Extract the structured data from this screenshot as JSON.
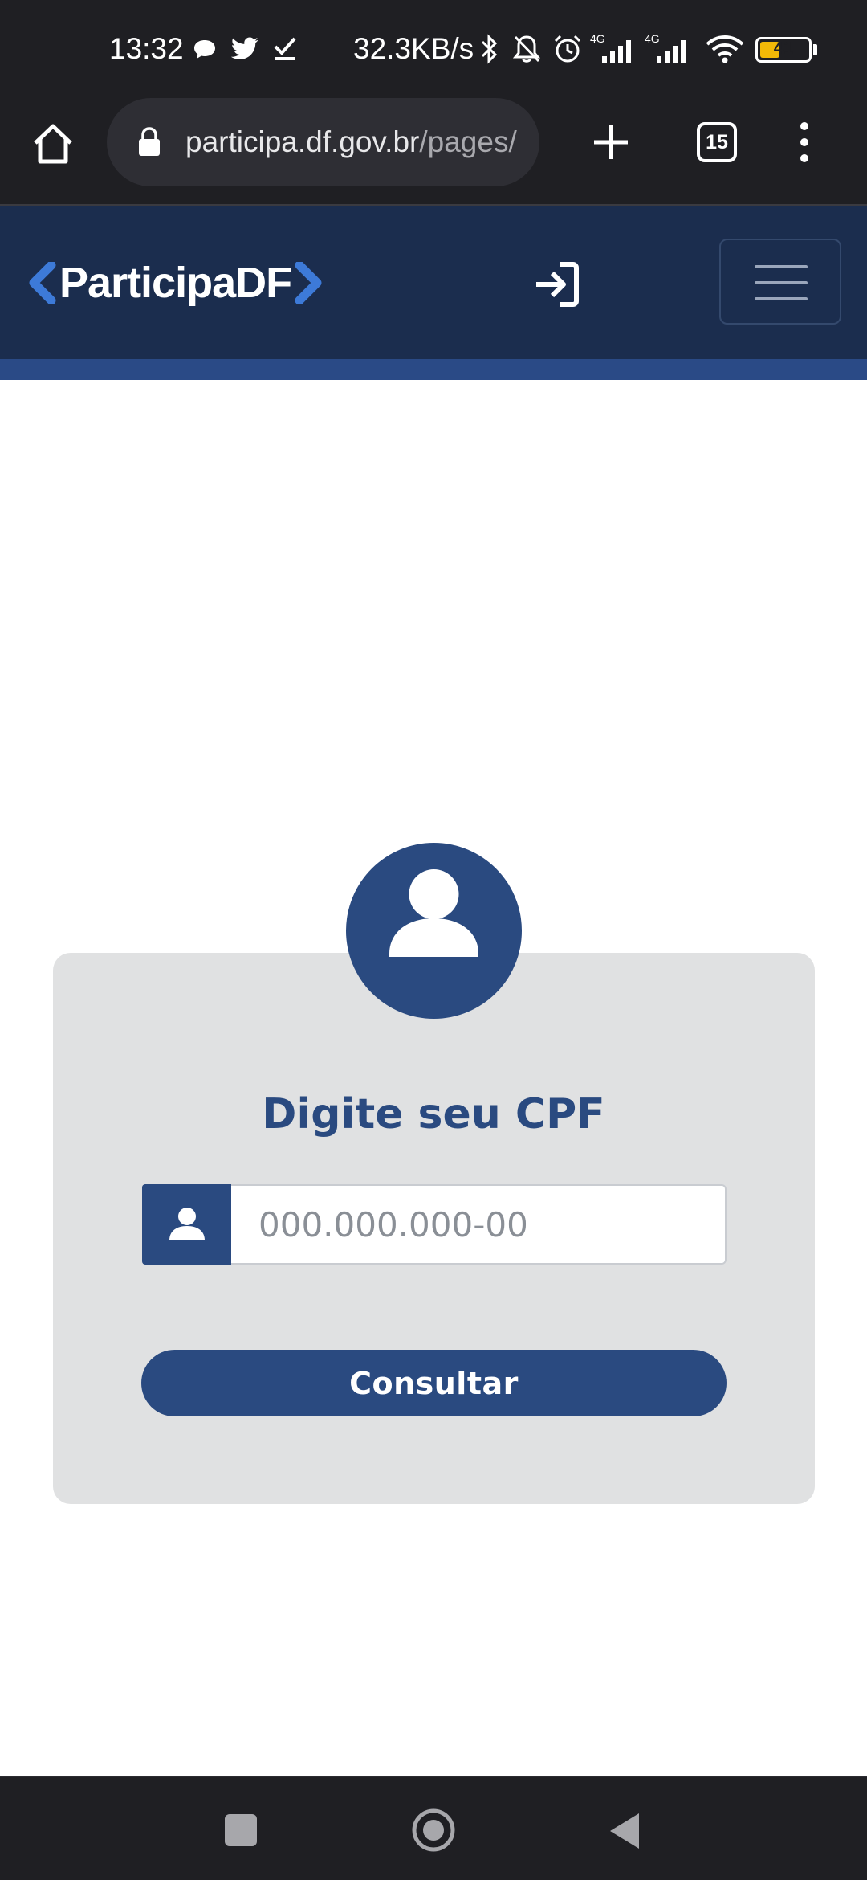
{
  "status_bar": {
    "time": "13:32",
    "net_speed": "32.3KB/s",
    "battery_level": "41",
    "battery_fraction": 0.41,
    "icons": [
      "chat-bubble-icon",
      "twitter-icon",
      "check-icon",
      "bluetooth-icon",
      "bell-off-icon",
      "alarm-icon",
      "signal-4g-icon",
      "signal-4g-icon",
      "wifi-icon",
      "battery-icon"
    ],
    "signal_label": "4G"
  },
  "browser": {
    "url_main": "participa.df.gov.br",
    "url_path": "/pages/",
    "tab_count": "15",
    "icons": {
      "home": "home-icon",
      "lock": "lock-icon",
      "new_tab": "plus-icon",
      "tabs": "tabs-icon",
      "menu": "kebab-menu-icon"
    }
  },
  "header": {
    "logo_text": "ParticipaDF",
    "login_icon": "login-icon",
    "menu_icon": "hamburger-icon",
    "colors": {
      "header_bg": "#1b2d4e",
      "stripe": "#2a4a86"
    }
  },
  "form": {
    "title": "Digite seu CPF",
    "cpf_placeholder": "000.000.000-00",
    "cpf_value": "",
    "submit_label": "Consultar",
    "colors": {
      "primary": "#2a4a80",
      "card_bg": "#e0e1e2"
    }
  },
  "nav_bar": {
    "buttons": [
      "recents-square-icon",
      "home-circle-icon",
      "back-triangle-icon"
    ]
  }
}
